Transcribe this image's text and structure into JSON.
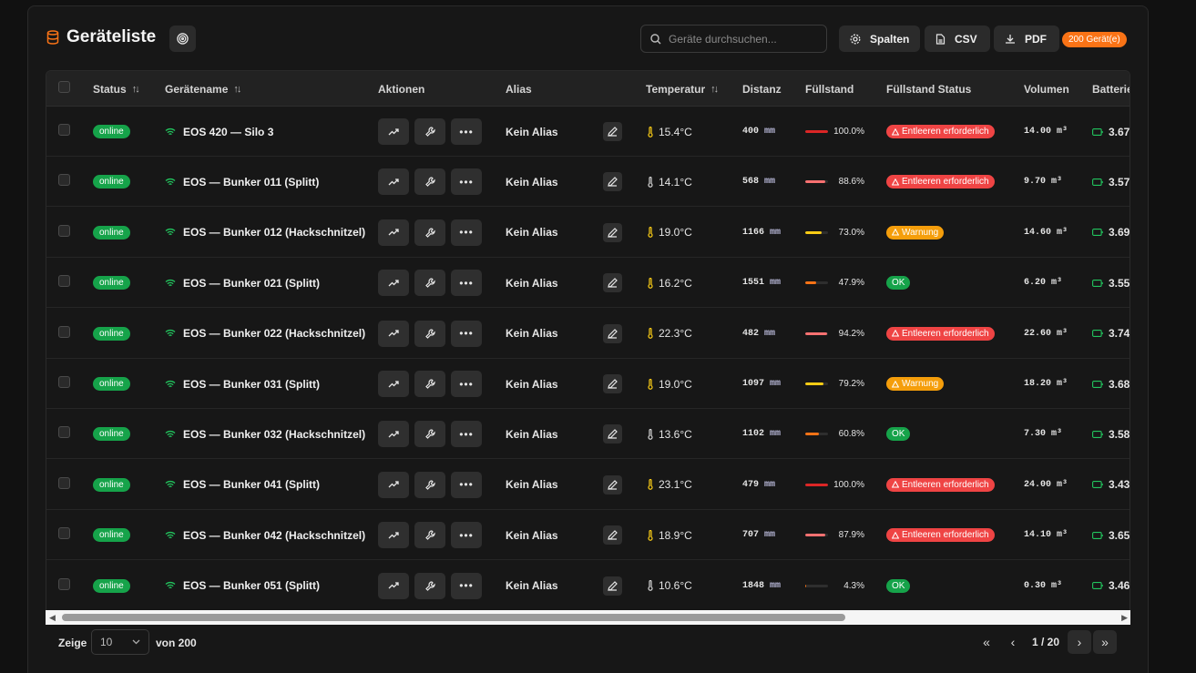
{
  "header": {
    "title": "Geräteliste",
    "search_placeholder": "Geräte durchsuchen...",
    "buttons": {
      "columns": "Spalten",
      "csv": "CSV",
      "pdf": "PDF"
    },
    "device_count": "200 Gerät(e)"
  },
  "table": {
    "columns": [
      "Status",
      "Gerätename",
      "Aktionen",
      "Alias",
      "Temperatur",
      "Distanz",
      "Füllstand",
      "Füllstand Status",
      "Volumen",
      "Batterie"
    ],
    "rows": [
      {
        "status": "online",
        "name": "EOS 420 — Silo 3",
        "alias": "Kein Alias",
        "temp": "15.4°C",
        "temp_color": "#facc15",
        "dist_val": "400",
        "dist_unit": "mm",
        "fill_pct": "100.0%",
        "fill": 1.0,
        "fill_color": "#dc2626",
        "fstatus": "Entleeren erforderlich",
        "fstatus_type": "danger",
        "vol": "14.00 m³",
        "batt": "3.67"
      },
      {
        "status": "online",
        "name": "EOS — Bunker 011 (Splitt)",
        "alias": "Kein Alias",
        "temp": "14.1°C",
        "temp_color": "#d4d4d4",
        "dist_val": "568",
        "dist_unit": "mm",
        "fill_pct": "88.6%",
        "fill": 0.886,
        "fill_color": "#f87171",
        "fstatus": "Entleeren erforderlich",
        "fstatus_type": "danger",
        "vol": "9.70 m³",
        "batt": "3.57"
      },
      {
        "status": "online",
        "name": "EOS — Bunker 012 (Hackschnitzel)",
        "alias": "Kein Alias",
        "temp": "19.0°C",
        "temp_color": "#facc15",
        "dist_val": "1166",
        "dist_unit": "mm",
        "fill_pct": "73.0%",
        "fill": 0.73,
        "fill_color": "#facc15",
        "fstatus": "Warnung",
        "fstatus_type": "warn",
        "vol": "14.60 m³",
        "batt": "3.69"
      },
      {
        "status": "online",
        "name": "EOS — Bunker 021 (Splitt)",
        "alias": "Kein Alias",
        "temp": "16.2°C",
        "temp_color": "#facc15",
        "dist_val": "1551",
        "dist_unit": "mm",
        "fill_pct": "47.9%",
        "fill": 0.479,
        "fill_color": "#f97316",
        "fstatus": "OK",
        "fstatus_type": "ok",
        "vol": "6.20 m³",
        "batt": "3.55"
      },
      {
        "status": "online",
        "name": "EOS — Bunker 022 (Hackschnitzel)",
        "alias": "Kein Alias",
        "temp": "22.3°C",
        "temp_color": "#facc15",
        "dist_val": "482",
        "dist_unit": "mm",
        "fill_pct": "94.2%",
        "fill": 0.942,
        "fill_color": "#f87171",
        "fstatus": "Entleeren erforderlich",
        "fstatus_type": "danger",
        "vol": "22.60 m³",
        "batt": "3.74"
      },
      {
        "status": "online",
        "name": "EOS — Bunker 031 (Splitt)",
        "alias": "Kein Alias",
        "temp": "19.0°C",
        "temp_color": "#facc15",
        "dist_val": "1097",
        "dist_unit": "mm",
        "fill_pct": "79.2%",
        "fill": 0.792,
        "fill_color": "#facc15",
        "fstatus": "Warnung",
        "fstatus_type": "warn",
        "vol": "18.20 m³",
        "batt": "3.68"
      },
      {
        "status": "online",
        "name": "EOS — Bunker 032 (Hackschnitzel)",
        "alias": "Kein Alias",
        "temp": "13.6°C",
        "temp_color": "#d4d4d4",
        "dist_val": "1102",
        "dist_unit": "mm",
        "fill_pct": "60.8%",
        "fill": 0.608,
        "fill_color": "#f97316",
        "fstatus": "OK",
        "fstatus_type": "ok",
        "vol": "7.30 m³",
        "batt": "3.58"
      },
      {
        "status": "online",
        "name": "EOS — Bunker 041 (Splitt)",
        "alias": "Kein Alias",
        "temp": "23.1°C",
        "temp_color": "#facc15",
        "dist_val": "479",
        "dist_unit": "mm",
        "fill_pct": "100.0%",
        "fill": 1.0,
        "fill_color": "#dc2626",
        "fstatus": "Entleeren erforderlich",
        "fstatus_type": "danger",
        "vol": "24.00 m³",
        "batt": "3.43"
      },
      {
        "status": "online",
        "name": "EOS — Bunker 042 (Hackschnitzel)",
        "alias": "Kein Alias",
        "temp": "18.9°C",
        "temp_color": "#facc15",
        "dist_val": "707",
        "dist_unit": "mm",
        "fill_pct": "87.9%",
        "fill": 0.879,
        "fill_color": "#f87171",
        "fstatus": "Entleeren erforderlich",
        "fstatus_type": "danger",
        "vol": "14.10 m³",
        "batt": "3.65"
      },
      {
        "status": "online",
        "name": "EOS — Bunker 051 (Splitt)",
        "alias": "Kein Alias",
        "temp": "10.6°C",
        "temp_color": "#d4d4d4",
        "dist_val": "1848",
        "dist_unit": "mm",
        "fill_pct": "4.3%",
        "fill": 0.043,
        "fill_color": "#f97316",
        "fstatus": "OK",
        "fstatus_type": "ok",
        "vol": "0.30 m³",
        "batt": "3.46"
      }
    ]
  },
  "footer": {
    "show_label": "Zeige",
    "page_size": "10",
    "of_label": "von 200",
    "page_info": "1 / 20"
  },
  "colors": {
    "accent": "#f97316",
    "online": "#16a34a",
    "danger": "#ef4444",
    "warn": "#f59e0b",
    "ok": "#16a34a"
  }
}
